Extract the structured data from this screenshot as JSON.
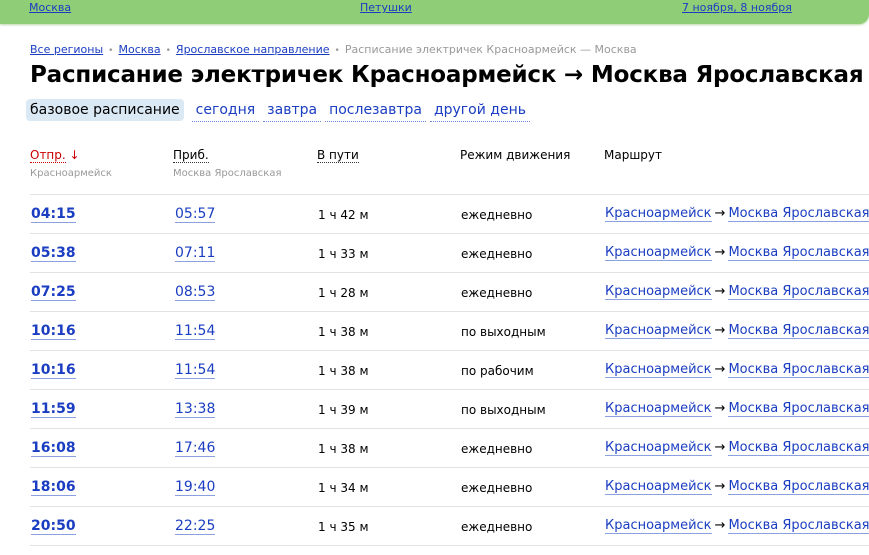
{
  "topbar": {
    "from": "Москва",
    "mid": "Петушки",
    "dates": "7 ноября, 8 ноября"
  },
  "breadcrumbs": {
    "items": [
      "Все регионы",
      "Москва",
      "Ярославское направление"
    ],
    "current": "Расписание электричек Красноармейск — Москва",
    "separator": "•"
  },
  "title": "Расписание электричек Красноармейск → Москва Ярославская",
  "day_tabs": [
    "базовое расписание",
    "сегодня",
    "завтра",
    "послезавтра",
    "другой день"
  ],
  "columns": {
    "dep": {
      "label": "Отпр.",
      "arrow": "↓",
      "sub": "Красноармейск"
    },
    "arr": {
      "label": "Приб.",
      "sub": "Москва Ярославская"
    },
    "dur": {
      "label": "В пути"
    },
    "mode": {
      "label": "Режим движения"
    },
    "route": {
      "label": "Маршрут"
    }
  },
  "trains": [
    {
      "dep": "04:15",
      "arr": "05:57",
      "dur": "1 ч 42 м",
      "mode": "ежедневно",
      "from": "Красноармейск",
      "to": "Москва Ярославская"
    },
    {
      "dep": "05:38",
      "arr": "07:11",
      "dur": "1 ч 33 м",
      "mode": "ежедневно",
      "from": "Красноармейск",
      "to": "Москва Ярославская"
    },
    {
      "dep": "07:25",
      "arr": "08:53",
      "dur": "1 ч 28 м",
      "mode": "ежедневно",
      "from": "Красноармейск",
      "to": "Москва Ярославская"
    },
    {
      "dep": "10:16",
      "arr": "11:54",
      "dur": "1 ч 38 м",
      "mode": "по выходным",
      "from": "Красноармейск",
      "to": "Москва Ярославская"
    },
    {
      "dep": "10:16",
      "arr": "11:54",
      "dur": "1 ч 38 м",
      "mode": "по рабочим",
      "from": "Красноармейск",
      "to": "Москва Ярославская"
    },
    {
      "dep": "11:59",
      "arr": "13:38",
      "dur": "1 ч 39 м",
      "mode": "по выходным",
      "from": "Красноармейск",
      "to": "Москва Ярославская"
    },
    {
      "dep": "16:08",
      "arr": "17:46",
      "dur": "1 ч 38 м",
      "mode": "ежедневно",
      "from": "Красноармейск",
      "to": "Москва Ярославская"
    },
    {
      "dep": "18:06",
      "arr": "19:40",
      "dur": "1 ч 34 м",
      "mode": "ежедневно",
      "from": "Красноармейск",
      "to": "Москва Ярославская"
    },
    {
      "dep": "20:50",
      "arr": "22:25",
      "dur": "1 ч 35 м",
      "mode": "ежедневно",
      "from": "Красноармейск",
      "to": "Москва Ярославская"
    }
  ],
  "route_arrow": "→",
  "colors": {
    "link": "#1a3dc1",
    "topbar": "#8fce76",
    "active_tab": "#dbe9f5",
    "sort_arrow": "#cc0000"
  }
}
